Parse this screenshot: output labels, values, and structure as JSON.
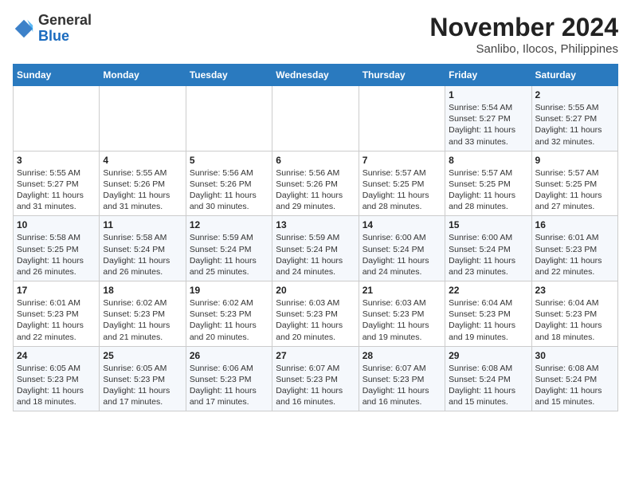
{
  "header": {
    "logo": {
      "line1": "General",
      "line2": "Blue"
    },
    "title": "November 2024",
    "location": "Sanlibo, Ilocos, Philippines"
  },
  "weekdays": [
    "Sunday",
    "Monday",
    "Tuesday",
    "Wednesday",
    "Thursday",
    "Friday",
    "Saturday"
  ],
  "weeks": [
    [
      {
        "day": "",
        "info": ""
      },
      {
        "day": "",
        "info": ""
      },
      {
        "day": "",
        "info": ""
      },
      {
        "day": "",
        "info": ""
      },
      {
        "day": "",
        "info": ""
      },
      {
        "day": "1",
        "info": "Sunrise: 5:54 AM\nSunset: 5:27 PM\nDaylight: 11 hours and 33 minutes."
      },
      {
        "day": "2",
        "info": "Sunrise: 5:55 AM\nSunset: 5:27 PM\nDaylight: 11 hours and 32 minutes."
      }
    ],
    [
      {
        "day": "3",
        "info": "Sunrise: 5:55 AM\nSunset: 5:27 PM\nDaylight: 11 hours and 31 minutes."
      },
      {
        "day": "4",
        "info": "Sunrise: 5:55 AM\nSunset: 5:26 PM\nDaylight: 11 hours and 31 minutes."
      },
      {
        "day": "5",
        "info": "Sunrise: 5:56 AM\nSunset: 5:26 PM\nDaylight: 11 hours and 30 minutes."
      },
      {
        "day": "6",
        "info": "Sunrise: 5:56 AM\nSunset: 5:26 PM\nDaylight: 11 hours and 29 minutes."
      },
      {
        "day": "7",
        "info": "Sunrise: 5:57 AM\nSunset: 5:25 PM\nDaylight: 11 hours and 28 minutes."
      },
      {
        "day": "8",
        "info": "Sunrise: 5:57 AM\nSunset: 5:25 PM\nDaylight: 11 hours and 28 minutes."
      },
      {
        "day": "9",
        "info": "Sunrise: 5:57 AM\nSunset: 5:25 PM\nDaylight: 11 hours and 27 minutes."
      }
    ],
    [
      {
        "day": "10",
        "info": "Sunrise: 5:58 AM\nSunset: 5:25 PM\nDaylight: 11 hours and 26 minutes."
      },
      {
        "day": "11",
        "info": "Sunrise: 5:58 AM\nSunset: 5:24 PM\nDaylight: 11 hours and 26 minutes."
      },
      {
        "day": "12",
        "info": "Sunrise: 5:59 AM\nSunset: 5:24 PM\nDaylight: 11 hours and 25 minutes."
      },
      {
        "day": "13",
        "info": "Sunrise: 5:59 AM\nSunset: 5:24 PM\nDaylight: 11 hours and 24 minutes."
      },
      {
        "day": "14",
        "info": "Sunrise: 6:00 AM\nSunset: 5:24 PM\nDaylight: 11 hours and 24 minutes."
      },
      {
        "day": "15",
        "info": "Sunrise: 6:00 AM\nSunset: 5:24 PM\nDaylight: 11 hours and 23 minutes."
      },
      {
        "day": "16",
        "info": "Sunrise: 6:01 AM\nSunset: 5:23 PM\nDaylight: 11 hours and 22 minutes."
      }
    ],
    [
      {
        "day": "17",
        "info": "Sunrise: 6:01 AM\nSunset: 5:23 PM\nDaylight: 11 hours and 22 minutes."
      },
      {
        "day": "18",
        "info": "Sunrise: 6:02 AM\nSunset: 5:23 PM\nDaylight: 11 hours and 21 minutes."
      },
      {
        "day": "19",
        "info": "Sunrise: 6:02 AM\nSunset: 5:23 PM\nDaylight: 11 hours and 20 minutes."
      },
      {
        "day": "20",
        "info": "Sunrise: 6:03 AM\nSunset: 5:23 PM\nDaylight: 11 hours and 20 minutes."
      },
      {
        "day": "21",
        "info": "Sunrise: 6:03 AM\nSunset: 5:23 PM\nDaylight: 11 hours and 19 minutes."
      },
      {
        "day": "22",
        "info": "Sunrise: 6:04 AM\nSunset: 5:23 PM\nDaylight: 11 hours and 19 minutes."
      },
      {
        "day": "23",
        "info": "Sunrise: 6:04 AM\nSunset: 5:23 PM\nDaylight: 11 hours and 18 minutes."
      }
    ],
    [
      {
        "day": "24",
        "info": "Sunrise: 6:05 AM\nSunset: 5:23 PM\nDaylight: 11 hours and 18 minutes."
      },
      {
        "day": "25",
        "info": "Sunrise: 6:05 AM\nSunset: 5:23 PM\nDaylight: 11 hours and 17 minutes."
      },
      {
        "day": "26",
        "info": "Sunrise: 6:06 AM\nSunset: 5:23 PM\nDaylight: 11 hours and 17 minutes."
      },
      {
        "day": "27",
        "info": "Sunrise: 6:07 AM\nSunset: 5:23 PM\nDaylight: 11 hours and 16 minutes."
      },
      {
        "day": "28",
        "info": "Sunrise: 6:07 AM\nSunset: 5:23 PM\nDaylight: 11 hours and 16 minutes."
      },
      {
        "day": "29",
        "info": "Sunrise: 6:08 AM\nSunset: 5:24 PM\nDaylight: 11 hours and 15 minutes."
      },
      {
        "day": "30",
        "info": "Sunrise: 6:08 AM\nSunset: 5:24 PM\nDaylight: 11 hours and 15 minutes."
      }
    ]
  ]
}
